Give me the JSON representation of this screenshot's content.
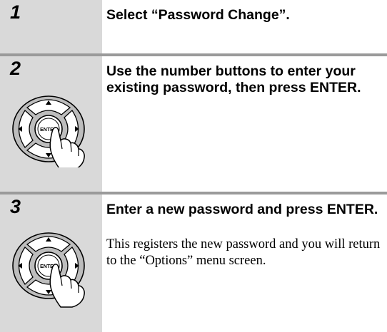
{
  "steps": [
    {
      "number": "1",
      "title": "Select “Password Change”."
    },
    {
      "number": "2",
      "title": "Use the number buttons to enter your existing password, then press ENTER.",
      "icon": "remote-enter-button-icon",
      "enter_label": "ENTER"
    },
    {
      "number": "3",
      "title": "Enter a new password and press ENTER.",
      "body": "This registers the new password and you will return to the “Options” menu screen.",
      "icon": "remote-enter-button-icon",
      "enter_label": "ENTER"
    }
  ],
  "colors": {
    "number_column": "#d9d9d9",
    "divider": "#9a9a9a"
  }
}
